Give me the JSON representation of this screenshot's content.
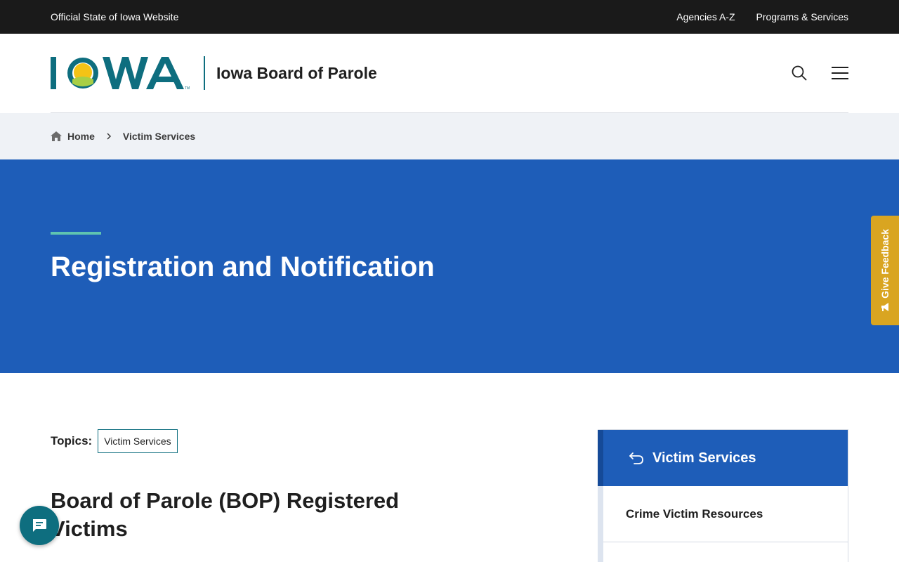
{
  "utility_bar": {
    "official_text": "Official State of Iowa Website",
    "links": [
      "Agencies A-Z",
      "Programs & Services"
    ]
  },
  "header": {
    "logo_text": "IOWA",
    "agency_name": "Iowa Board of Parole"
  },
  "breadcrumb": {
    "home": "Home",
    "current": "Victim Services"
  },
  "hero": {
    "title": "Registration and Notification"
  },
  "main": {
    "topics_label": "Topics:",
    "topic_tag": "Victim Services",
    "article_title": "Board of Parole (BOP) Registered Victims"
  },
  "side_nav": {
    "header": "Victim Services",
    "items": [
      "Crime Victim Resources"
    ]
  },
  "feedback": {
    "label": "Give Feedback"
  },
  "colors": {
    "utility_bg": "#1a1a1a",
    "brand_teal": "#0e6e7f",
    "hero_blue": "#1e5db8",
    "accent_green": "#5fc4b0",
    "feedback_gold": "#d9a521",
    "breadcrumb_bg": "#eff2f6"
  }
}
